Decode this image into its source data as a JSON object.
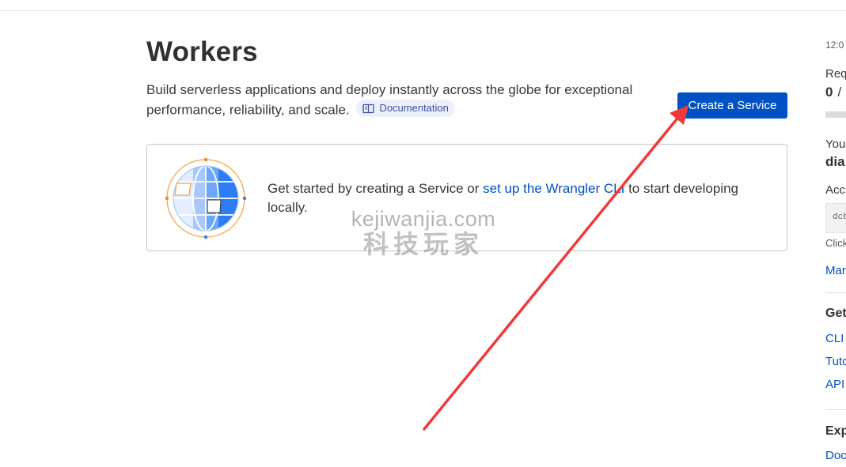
{
  "header": {
    "title": "Workers",
    "description": "Build serverless applications and deploy instantly across the globe for exceptional performance, reliability, and scale.",
    "doc_link": "Documentation",
    "create_button": "Create a Service"
  },
  "card": {
    "text_before": "Get started by creating a Service or ",
    "link": "set up the Wrangler CLI",
    "text_after": " to start developing locally."
  },
  "watermark": {
    "line1": "kejiwanjia.com",
    "line2": "科技玩家"
  },
  "sidebar": {
    "time": "12:0",
    "requests_label": "Req",
    "requests_value": "0",
    "requests_sep": "/",
    "your_label": "You",
    "subdomain": "dia",
    "account_label": "Acc",
    "account_id": "dcb",
    "click_hint": "Click",
    "manage_link": "Mar",
    "get_started_heading": "Get",
    "links": [
      "CLI",
      "Tuto",
      "API"
    ],
    "explore_heading": "Exp",
    "docs_link": "Doc"
  },
  "colors": {
    "accent": "#0051c3",
    "annotation_arrow": "#f03a3a",
    "globe_blue": "#2c7cf6",
    "globe_orange": "#f6821f"
  }
}
